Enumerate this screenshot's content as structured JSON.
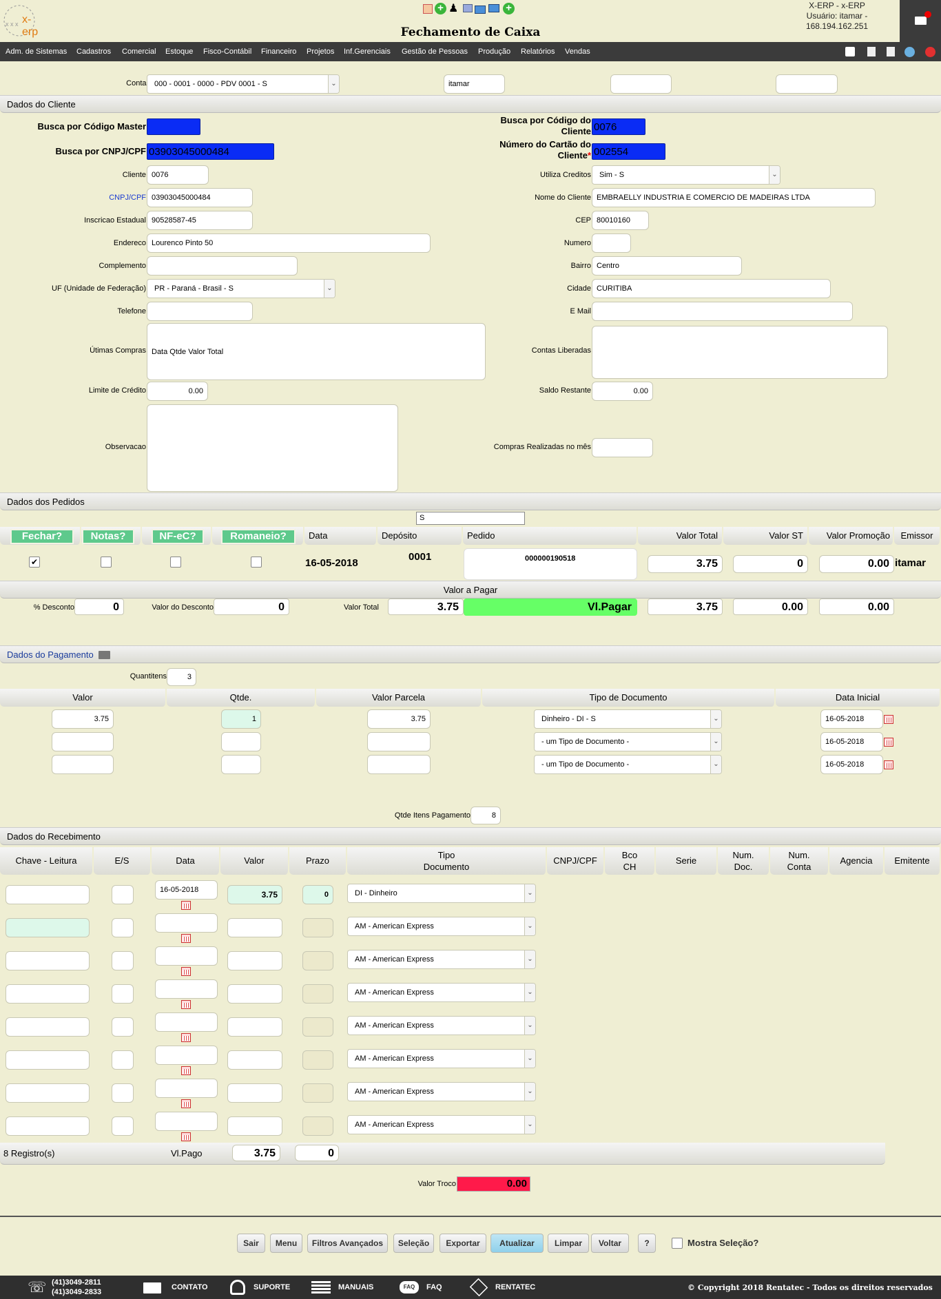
{
  "header": {
    "logo": "x-erp",
    "title": "Fechamento de Caixa",
    "user_line1": "X-ERP - x-ERP",
    "user_line2": "Usuário: itamar -",
    "user_line3": "168.194.162.251"
  },
  "menu": [
    "Adm. de Sistemas",
    "Cadastros",
    "Comercial",
    "Estoque",
    "Fisco-Contábil",
    "Financeiro",
    "Projetos",
    "Inf.Gerenciais",
    "Gestão de Pessoas",
    "Produção",
    "Relatórios",
    "Vendas"
  ],
  "contas": {
    "label": "Contas",
    "value": "000 - 0001 - 0000 - PDV 0001 - S",
    "user": "itamar",
    "extra1": "",
    "extra2": ""
  },
  "cliente": {
    "section": "Dados do Cliente",
    "busca_master_label": "Busca por Código Master",
    "busca_master": "",
    "busca_codigo_label": "Busca por Código do Cliente",
    "busca_codigo": "0076",
    "busca_cnpj_label": "Busca por CNPJ/CPF",
    "busca_cnpj": "03903045000484",
    "cartao_label": "Número do Cartão do Cliente",
    "cartao_req": "*",
    "cartao": "002554",
    "cliente_label": "Cliente",
    "cliente": "0076",
    "utiliza_label": "Utiliza Creditos",
    "utiliza": "Sim - S",
    "cnpj_label": "CNPJ/CPF",
    "cnpj": "03903045000484",
    "nome_label": "Nome do Cliente",
    "nome": "EMBRAELLY INDUSTRIA E COMERCIO DE MADEIRAS LTDA",
    "ie_label": "Inscricao Estadual",
    "ie": "90528587-45",
    "cep_label": "CEP",
    "cep": "80010160",
    "endereco_label": "Endereco",
    "endereco": "Lourenco Pinto 50",
    "numero_label": "Numero",
    "numero": "",
    "complemento_label": "Complemento",
    "complemento": "",
    "bairro_label": "Bairro",
    "bairro": "Centro",
    "uf_label": "UF (Unidade de Federação)",
    "uf": "PR - Paraná - Brasil - S",
    "cidade_label": "Cidade",
    "cidade": "CURITIBA",
    "telefone_label": "Telefone",
    "telefone": "",
    "email_label": "E Mail",
    "email": "",
    "ultimas_label": "Útimas Compras",
    "ultimas": "Data Qtde Valor Total",
    "contas_lib_label": "Contas Liberadas",
    "contas_lib": "",
    "limite_label": "Limite de Crédito",
    "limite": "0.00",
    "saldo_label": "Saldo Restante",
    "saldo": "0.00",
    "obs_label": "Observacao",
    "obs": "",
    "compras_mes_label": "Compras Realizadas no mês",
    "compras_mes": ""
  },
  "pedidos": {
    "section": "Dados dos Pedidos",
    "filtro": "S",
    "btn_fechar": "Fechar?",
    "btn_notas": "Notas?",
    "btn_nfe": "NF-eC?",
    "btn_romaneio": "Romaneio?",
    "h_data": "Data",
    "h_deposito": "Depósito",
    "h_pedido": "Pedido",
    "h_valor_total": "Valor Total",
    "h_valor_st": "Valor ST",
    "h_valor_promo": "Valor Promoção",
    "h_emissor": "Emissor",
    "row": {
      "data": "16-05-2018",
      "deposito": "0001",
      "pedido": "000000190518",
      "valor_total": "3.75",
      "valor_st": "0",
      "valor_promo": "0.00",
      "emissor": "itamar"
    },
    "valor_pagar": "Valor a Pagar",
    "desc_pct_label": "% Desconto",
    "desc_pct": "0",
    "desc_val_label": "Valor do Desconto",
    "desc_val": "0",
    "vt_label": "Valor Total",
    "vt": "3.75",
    "vlpagar_label": "Vl.Pagar",
    "vlpagar": "3.75",
    "t2": "0.00",
    "t3": "0.00"
  },
  "pagamento": {
    "section": "Dados do Pagamento",
    "qtd_label": "Quantitens",
    "qtd": "3",
    "h_valor": "Valor",
    "h_qtde": "Qtde.",
    "h_parcela": "Valor Parcela",
    "h_tipo": "Tipo de Documento",
    "h_data": "Data Inicial",
    "rows": [
      {
        "valor": "3.75",
        "qtde": "1",
        "parcela": "3.75",
        "tipo": "Dinheiro - DI - S",
        "data": "16-05-2018"
      },
      {
        "valor": "",
        "qtde": "",
        "parcela": "",
        "tipo": "- um Tipo de Documento -",
        "data": "16-05-2018"
      },
      {
        "valor": "",
        "qtde": "",
        "parcela": "",
        "tipo": "- um Tipo de Documento -",
        "data": "16-05-2018"
      }
    ],
    "qtd_itens_label": "Qtde Itens Pagamento",
    "qtd_itens": "8"
  },
  "recebimento": {
    "section": "Dados do Recebimento",
    "h_chave": "Chave - Leitura",
    "h_es": "E/S",
    "h_data": "Data",
    "h_valor": "Valor",
    "h_prazo": "Prazo",
    "h_tipo1": "Tipo",
    "h_tipo2": "Documento",
    "h_cnpj": "CNPJ/CPF",
    "h_bco1": "Bco",
    "h_bco2": "CH",
    "h_serie": "Serie",
    "h_numdoc1": "Num.",
    "h_numdoc2": "Doc.",
    "h_numconta1": "Num.",
    "h_numconta2": "Conta",
    "h_agencia": "Agencia",
    "h_emitente": "Emitente",
    "rows": [
      {
        "data": "16-05-2018",
        "valor": "3.75",
        "prazo": "0",
        "tipo": "DI - Dinheiro"
      },
      {
        "data": "",
        "valor": "",
        "prazo": "",
        "tipo": "AM - American Express"
      },
      {
        "data": "",
        "valor": "",
        "prazo": "",
        "tipo": "AM - American Express"
      },
      {
        "data": "",
        "valor": "",
        "prazo": "",
        "tipo": "AM - American Express"
      },
      {
        "data": "",
        "valor": "",
        "prazo": "",
        "tipo": "AM - American Express"
      },
      {
        "data": "",
        "valor": "",
        "prazo": "",
        "tipo": "AM - American Express"
      },
      {
        "data": "",
        "valor": "",
        "prazo": "",
        "tipo": "AM - American Express"
      },
      {
        "data": "",
        "valor": "",
        "prazo": "",
        "tipo": "AM - American Express"
      }
    ],
    "registros": "8 Registro(s)",
    "vlpago_label": "Vl.Pago",
    "vlpago": "3.75",
    "prazo_total": "0",
    "troco_label": "Valor Troco",
    "troco": "0.00"
  },
  "buttons": {
    "sair": "Sair",
    "menu": "Menu",
    "filtros": "Filtros Avançados",
    "selecao": "Seleção",
    "exportar": "Exportar",
    "atualizar": "Atualizar",
    "limpar": "Limpar",
    "voltar": "Voltar",
    "help": "?",
    "mostra": "Mostra Seleção?"
  },
  "footer": {
    "phone1": "(41)3049-2811",
    "phone2": "(41)3049-2833",
    "contato": "CONTATO",
    "suporte": "SUPORTE",
    "manuais": "MANUAIS",
    "faq": "FAQ",
    "rentatec": "RENTATEC",
    "copyright": "© Copyright 2018 Rentatec - Todos os direitos reservados"
  },
  "colors": {
    "background": "#efeed3",
    "blue_field": "#0a2cf5",
    "green_button": "#5ec98c",
    "pagar_green": "#66ff66",
    "troco_red": "#ff1a4a"
  }
}
